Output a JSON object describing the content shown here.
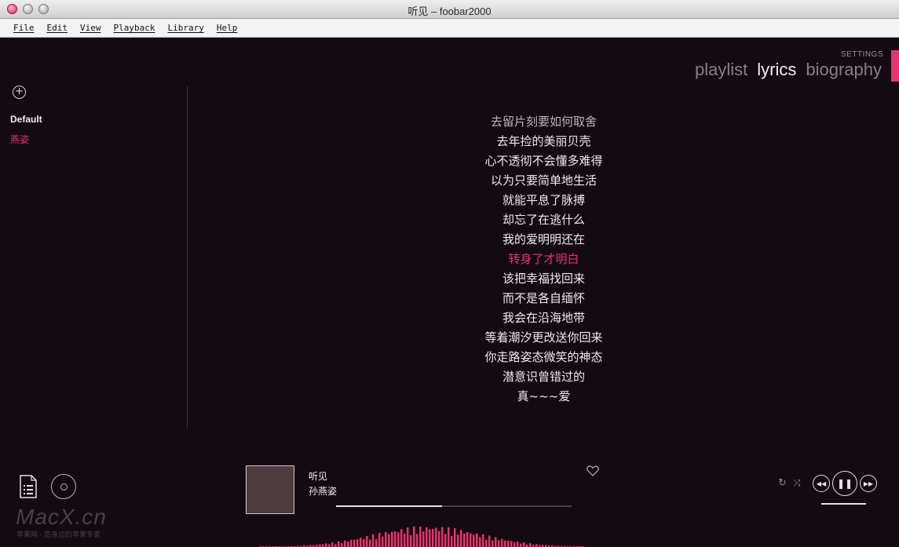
{
  "window": {
    "title": "听见 – foobar2000"
  },
  "menu": [
    "File",
    "Edit",
    "View",
    "Playback",
    "Library",
    "Help"
  ],
  "header": {
    "settings_label": "SETTINGS",
    "tabs": [
      {
        "label": "playlist",
        "active": false
      },
      {
        "label": "lyrics",
        "active": true
      },
      {
        "label": "biography",
        "active": false
      }
    ]
  },
  "sidebar": {
    "add_icon": "plus-circle-icon",
    "playlists": [
      {
        "label": "Default"
      },
      {
        "label": "燕姿"
      }
    ]
  },
  "lyrics": {
    "current_index": 7,
    "lines": [
      "去留片刻要如何取舍",
      "去年捡的美丽贝壳",
      "心不透彻不会懂多难得",
      "以为只要简单地生活",
      "就能平息了脉搏",
      "却忘了在逃什么",
      "我的爱明明还在",
      "转身了才明白",
      "该把幸福找回来",
      "而不是各自缅怀",
      "我会在沿海地带",
      "等着潮汐更改送你回来",
      "你走路姿态微笑的神态",
      "潜意识曾错过的",
      "真~~~爱"
    ]
  },
  "now_playing": {
    "title": "听见",
    "artist": "孙燕姿",
    "progress": 0.45
  },
  "watermark": {
    "brand": "MacX.cn",
    "tagline": "苹果网 - 您身边的苹果专家"
  },
  "controls": {
    "repeat_icon": "repeat-icon",
    "shuffle_icon": "shuffle-icon",
    "prev_icon": "rewind-icon",
    "pause_icon": "pause-icon",
    "next_icon": "fast-forward-icon"
  },
  "colors": {
    "accent": "#e8336c",
    "background": "#140a12",
    "text": "#efe9ee"
  }
}
